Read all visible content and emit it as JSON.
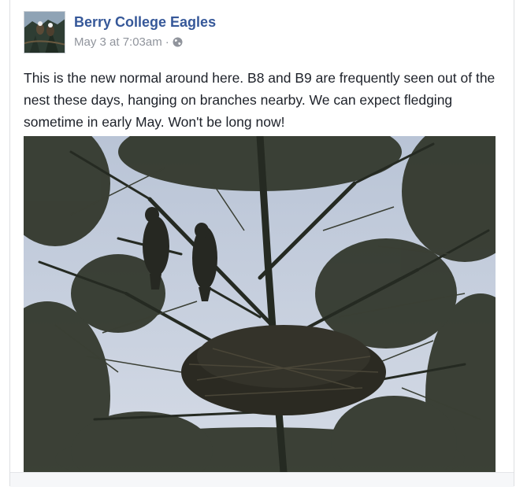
{
  "post": {
    "page_name": "Berry College Eagles",
    "timestamp": "May 3 at 7:03am",
    "separator": "·",
    "privacy_icon": "globe-icon",
    "text": "This is the new normal around here. B8 and B9 are frequently seen out of the nest these days, hanging on branches nearby. We can expect fledging sometime in early May. Won't be long now!",
    "photo": {
      "subject": "eagle-nest-photo"
    }
  },
  "colors": {
    "link": "#365899",
    "meta": "#90949c",
    "body_text": "#1d2129",
    "border": "#dddfe2"
  }
}
